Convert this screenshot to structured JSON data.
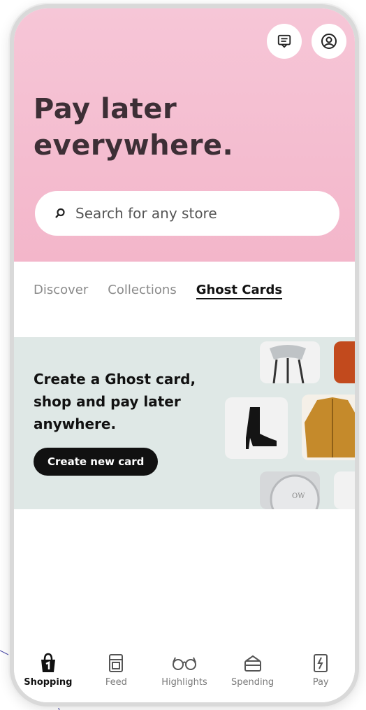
{
  "hero": {
    "title_line1": "Pay later",
    "title_line2": "everywhere.",
    "background_color": "#f6c6d7"
  },
  "top_icons": [
    {
      "name": "messages-icon"
    },
    {
      "name": "profile-icon"
    }
  ],
  "search": {
    "placeholder": "Search for any store"
  },
  "tabs": [
    {
      "label": "Discover",
      "active": false
    },
    {
      "label": "Collections",
      "active": false
    },
    {
      "label": "Ghost Cards",
      "active": true
    }
  ],
  "banner": {
    "line1": "Create a Ghost card,",
    "line2": "shop and pay later",
    "line3": "anywhere.",
    "button_label": "Create new card",
    "background_color": "#dfe8e6",
    "watch_text": "OW"
  },
  "bottom_nav": [
    {
      "label": "Shopping",
      "icon": "shopping-bag-icon",
      "active": true
    },
    {
      "label": "Feed",
      "icon": "feed-icon",
      "active": false
    },
    {
      "label": "Highlights",
      "icon": "glasses-icon",
      "active": false
    },
    {
      "label": "Spending",
      "icon": "wallet-icon",
      "active": false
    },
    {
      "label": "Pay",
      "icon": "receipt-icon",
      "active": false
    }
  ]
}
